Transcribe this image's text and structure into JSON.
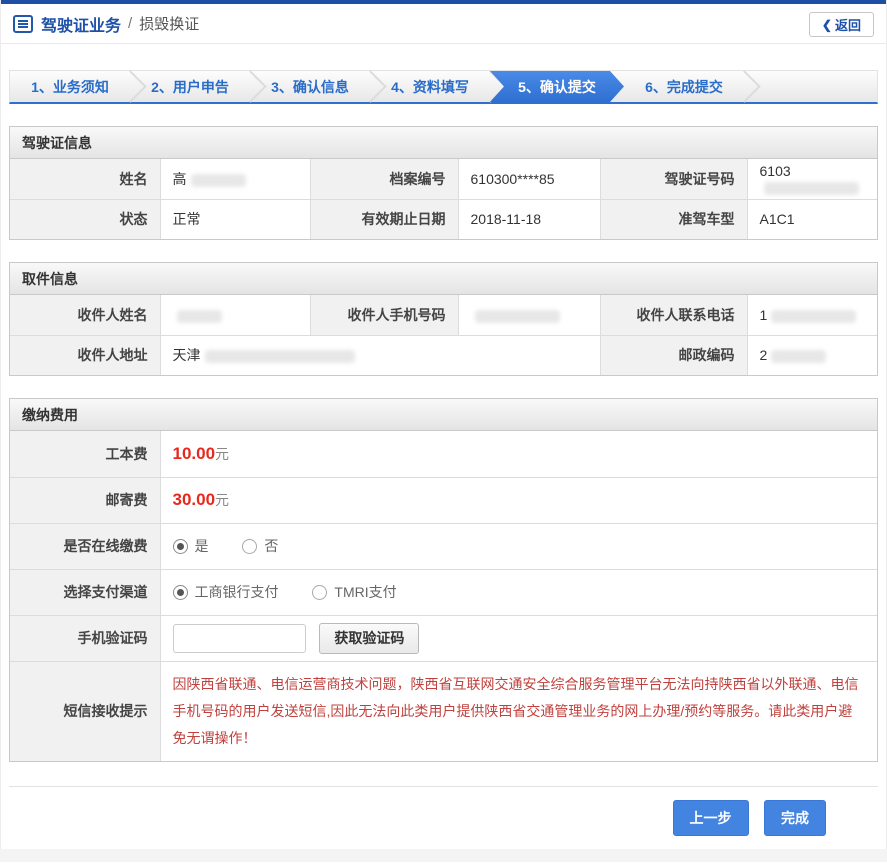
{
  "header": {
    "title_primary": "驾驶证业务",
    "title_separator": "/",
    "title_secondary": "损毁换证",
    "back_label": "返回",
    "back_icon_glyph": "❮"
  },
  "steps": [
    {
      "label": "1、业务须知",
      "active": false
    },
    {
      "label": "2、用户申告",
      "active": false
    },
    {
      "label": "3、确认信息",
      "active": false
    },
    {
      "label": "4、资料填写",
      "active": false
    },
    {
      "label": "5、确认提交",
      "active": true
    },
    {
      "label": "6、完成提交",
      "active": false
    }
  ],
  "sections": {
    "license": {
      "title": "驾驶证信息",
      "fields": [
        {
          "label": "姓名",
          "value_prefix": "高",
          "redacted": true
        },
        {
          "label": "档案编号",
          "value": "610300****85",
          "redacted": false
        },
        {
          "label": "驾驶证号码",
          "value_prefix": "6103",
          "redacted": true
        },
        {
          "label": "状态",
          "value": "正常",
          "redacted": false
        },
        {
          "label": "有效期止日期",
          "value": "2018-11-18",
          "redacted": false
        },
        {
          "label": "准驾车型",
          "value": "A1C1",
          "redacted": false
        }
      ]
    },
    "pickup": {
      "title": "取件信息",
      "fields": [
        {
          "label": "收件人姓名",
          "value_prefix": "",
          "redacted": true
        },
        {
          "label": "收件人手机号码",
          "value_prefix": "",
          "redacted": true
        },
        {
          "label": "收件人联系电话",
          "value_prefix": "1",
          "redacted": true
        },
        {
          "label": "收件人地址",
          "value_prefix": "天津",
          "redacted": true
        },
        {
          "label": "邮政编码",
          "value_prefix": "2",
          "redacted": true
        }
      ]
    },
    "payment": {
      "title": "缴纳费用",
      "fees": [
        {
          "label": "工本费",
          "amount": "10.00",
          "unit": "元"
        },
        {
          "label": "邮寄费",
          "amount": "30.00",
          "unit": "元"
        }
      ],
      "online": {
        "label": "是否在线缴费",
        "options": [
          {
            "label": "是",
            "selected": true
          },
          {
            "label": "否",
            "selected": false
          }
        ]
      },
      "channel": {
        "label": "选择支付渠道",
        "options": [
          {
            "label": "工商银行支付",
            "selected": true
          },
          {
            "label": "TMRI支付",
            "selected": false
          }
        ]
      },
      "sms": {
        "label": "手机验证码",
        "input_value": "",
        "button_label": "获取验证码"
      },
      "notice": {
        "label": "短信接收提示",
        "text_part1": "因陕西省联通、电信运营商技术问题，陕西省互联网交通安全综合服务管理平台",
        "text_bold": "无法向持陕西省以外联通、电信手机号码的用户发送短信,",
        "text_part2": "因此无法向此类用户提供陕西省交通管理业务的网上办理/预约等服务。请此类用户避免无谓操作！"
      }
    }
  },
  "footer": {
    "prev_label": "上一步",
    "finish_label": "完成"
  },
  "colors": {
    "top_accent": "#1d4fa5",
    "active_step_blue": "#2e6fd0",
    "primary_button_blue": "#4384e0",
    "amount_red": "#e8281e",
    "notice_red": "#c0413d"
  }
}
